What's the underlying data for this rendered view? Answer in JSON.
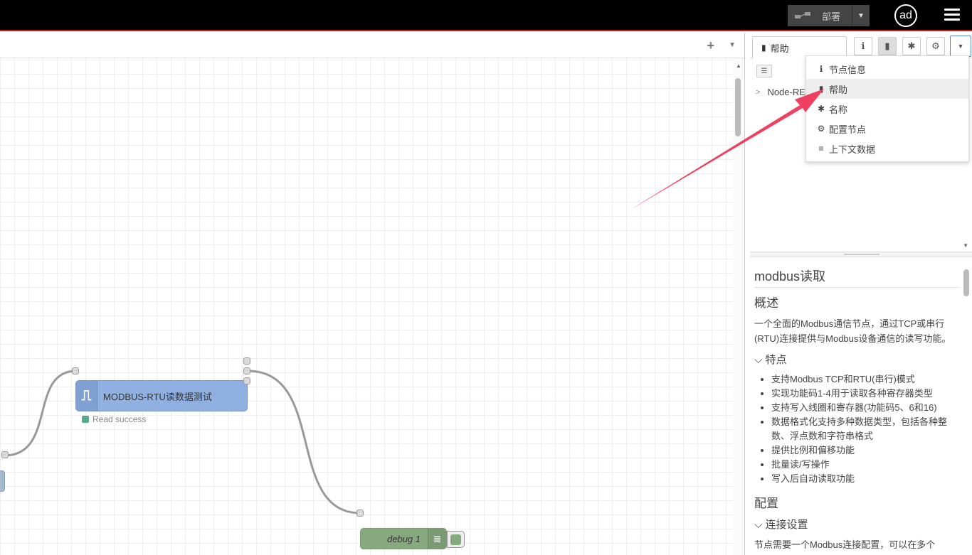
{
  "header": {
    "deploy_label": "部署",
    "user_initials": "ad",
    "deploy_icon": "deploy-icon",
    "menu_icon": "hamburger-icon"
  },
  "workspace": {
    "add_tab_label": "+",
    "nodes": {
      "modbus": {
        "label": "MODBUS-RTU读数据测试",
        "status": "Read success",
        "color": "#8fb0e0"
      },
      "debug": {
        "label": "debug 1",
        "color": "#87a980"
      }
    }
  },
  "sidebar": {
    "active_tab": "帮助",
    "tree_item": "Node-RE",
    "menu": [
      {
        "icon": "info-icon",
        "glyph": "ℹ",
        "label": "节点信息"
      },
      {
        "icon": "book-icon",
        "glyph": "▮",
        "label": "帮助"
      },
      {
        "icon": "bug-icon",
        "glyph": "✱",
        "label": "名称"
      },
      {
        "icon": "gear-icon",
        "glyph": "⚙",
        "label": "配置节点"
      },
      {
        "icon": "database-icon",
        "glyph": "≡",
        "label": "上下文数据"
      }
    ],
    "help": {
      "title": "modbus读取",
      "overview_heading": "概述",
      "overview_text": "一个全面的Modbus通信节点，通过TCP或串行(RTU)连接提供与Modbus设备通信的读写功能。",
      "features_heading": "特点",
      "features": [
        "支持Modbus TCP和RTU(串行)模式",
        "实现功能码1-4用于读取各种寄存器类型",
        "支持写入线圈和寄存器(功能码5、6和16)",
        "数据格式化支持多种数据类型，包括各种整数、浮点数和字符串格式",
        "提供比例和偏移功能",
        "批量读/写操作",
        "写入后自动读取功能"
      ],
      "config_heading": "配置",
      "conn_heading": "连接设置",
      "conn_text": "节点需要一个Modbus连接配置，可以在多个"
    }
  },
  "colors": {
    "header_bg": "#000000",
    "header_accent": "#c02020",
    "arrow": "#f04060"
  }
}
